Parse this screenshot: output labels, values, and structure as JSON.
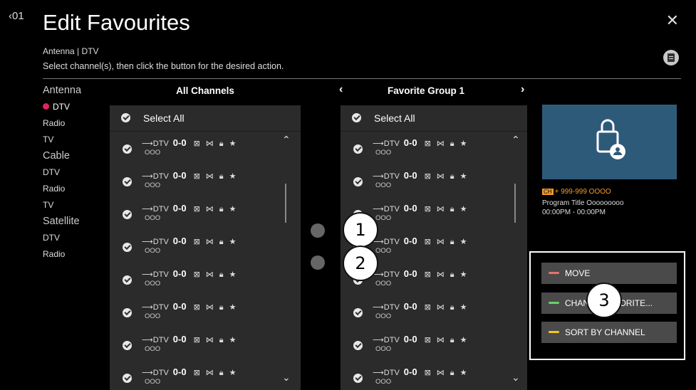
{
  "header": {
    "back_label": "‹01",
    "title": "Edit Favourites",
    "close_icon": "✕",
    "source": "Antenna | DTV",
    "instruction": "Select channel(s), then click the button for the desired action."
  },
  "sidebar": {
    "groups": [
      {
        "label": "Antenna",
        "items": [
          "DTV",
          "Radio",
          "TV"
        ]
      },
      {
        "label": "Cable",
        "items": [
          "DTV",
          "Radio",
          "TV"
        ]
      },
      {
        "label": "Satellite",
        "items": [
          "DTV",
          "Radio"
        ]
      }
    ],
    "active_color": "#e0245e"
  },
  "all_channels": {
    "title": "All Channels",
    "select_all": "Select All",
    "channel_type": "DTV",
    "channel_number": "0-0",
    "channel_name": "OOO",
    "row_count": 8
  },
  "favorite_group": {
    "prev_arrow": "‹",
    "title": "Favorite Group 1",
    "next_arrow": "›",
    "select_all": "Select All",
    "channel_type": "DTV",
    "channel_number": "0-0",
    "channel_name": "OOO",
    "row_count": 8
  },
  "callouts": {
    "one": "1",
    "two": "2",
    "three": "3"
  },
  "preview": {
    "channel": "999-999 OOOO",
    "program_title": "Program Title Ooooooooo",
    "time": "00:00PM - 00:00PM",
    "badge": "CH",
    "bg_color": "#2e5a7a"
  },
  "actions": {
    "move": {
      "label": "MOVE",
      "color": "#e8736e"
    },
    "change": {
      "label": "CHANGE FAVORITE...",
      "color": "#6ad06a"
    },
    "sort": {
      "label": "SORT BY CHANNEL",
      "color": "#f5c51f"
    }
  }
}
